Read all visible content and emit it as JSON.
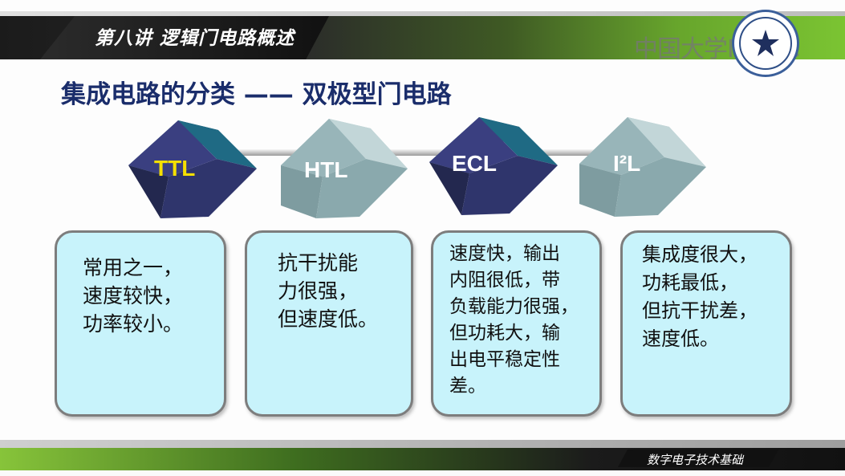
{
  "header": {
    "lecture_title": "第八讲  逻辑门电路概述",
    "mooc_watermark": "中国大学MOOC"
  },
  "slide": {
    "heading": "集成电路的分类 —— 双极型门电路"
  },
  "cubes": [
    {
      "label": "TTL",
      "color": "#f5e000",
      "face": "#2f356c"
    },
    {
      "label": "HTL",
      "color": "#ffffff",
      "face": "#8aa9ad"
    },
    {
      "label": "ECL",
      "color": "#ffffff",
      "face": "#2f356c"
    },
    {
      "label": "I²L",
      "color": "#ffffff",
      "face": "#8aa9ad"
    }
  ],
  "cards": [
    {
      "text": "常用之一，\n速度较快，\n功率较小。"
    },
    {
      "text": "抗干扰能\n力很强，\n但速度低。"
    },
    {
      "text": "速度快，输出\n内阻很低，带\n负载能力很强，\n但功耗大，输\n出电平稳定性\n差。"
    },
    {
      "text": "集成度很大，\n功耗最低，\n但抗干扰差，\n速度低。"
    }
  ],
  "footer": {
    "course_name": "数字电子技术基础"
  },
  "colors": {
    "heading": "#1a2d6b",
    "card_bg": "#c8f3fb",
    "green_accent": "#7bc432"
  }
}
